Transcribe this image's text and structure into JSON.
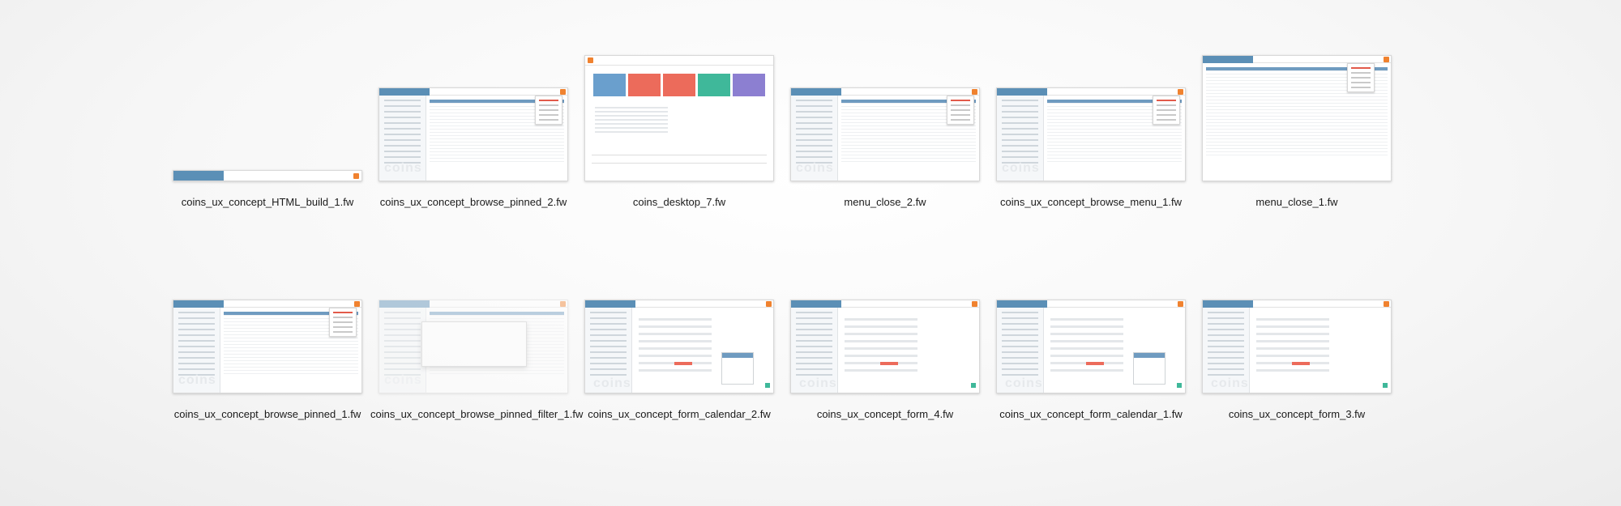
{
  "files": [
    {
      "caption": "coins_ux_concept_HTML_build_1.fw",
      "variant": "html-build"
    },
    {
      "caption": "coins_ux_concept_browse_pinned_2.fw",
      "variant": "browse-pinned"
    },
    {
      "caption": "coins_desktop_7.fw",
      "variant": "desktop"
    },
    {
      "caption": "menu_close_2.fw",
      "variant": "menu-close"
    },
    {
      "caption": "coins_ux_concept_browse_menu_1.fw",
      "variant": "browse-menu"
    },
    {
      "caption": "menu_close_1.fw",
      "variant": "menu-close-tall"
    },
    {
      "caption": "coins_ux_concept_browse_pinned_1.fw",
      "variant": "browse-pinned"
    },
    {
      "caption": "coins_ux_concept_browse_pinned_filter_1.fw",
      "variant": "filter"
    },
    {
      "caption": "coins_ux_concept_form_calendar_2.fw",
      "variant": "form-calendar"
    },
    {
      "caption": "coins_ux_concept_form_4.fw",
      "variant": "form"
    },
    {
      "caption": "coins_ux_concept_form_calendar_1.fw",
      "variant": "form-calendar"
    },
    {
      "caption": "coins_ux_concept_form_3.fw",
      "variant": "form"
    }
  ],
  "colors": {
    "header_blue": "#5b8fb6",
    "accent_orange": "#f0822f",
    "tile_blue": "#6a9fcd",
    "tile_red": "#ec6b5b",
    "tile_green": "#3fb89a",
    "tile_purple": "#8c7fd1"
  },
  "watermark_text": "coins"
}
